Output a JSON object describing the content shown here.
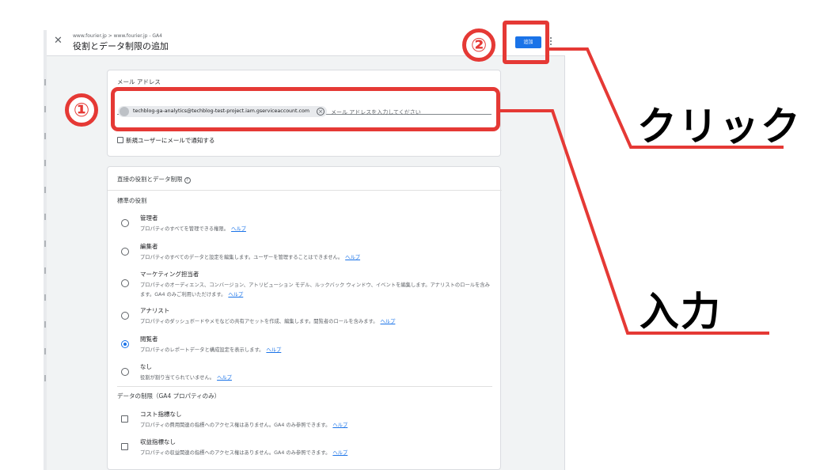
{
  "header": {
    "breadcrumb": "www.fourier.jp > www.fourier.jp - GA4",
    "title": "役割とデータ制限の追加",
    "add_label": "追加"
  },
  "email": {
    "section_label": "メール アドレス",
    "chip_text": "techblog-ga-analytics@techblog-test-project.iam.gserviceaccount.com",
    "placeholder": "メール アドレスを入力してください",
    "notify_label": "新規ユーザーにメールで通知する",
    "notify_checked": false
  },
  "roles": {
    "section_title": "直接の役割とデータ制限",
    "standard_title": "標準の役割",
    "items": [
      {
        "name": "管理者",
        "desc": "プロパティのすべてを管理できる権限。",
        "help": "ヘルプ",
        "selected": false
      },
      {
        "name": "編集者",
        "desc": "プロパティのすべてのデータと設定を編集します。ユーザーを管理することはできません。",
        "help": "ヘルプ",
        "selected": false
      },
      {
        "name": "マーケティング担当者",
        "desc": "プロパティのオーディエンス、コンバージョン、アトリビューション モデル、ルックバック ウィンドウ、イベントを編集します。アナリストのロールを含みます。GA4 のみご利用いただけます。",
        "help": "ヘルプ",
        "selected": false
      },
      {
        "name": "アナリスト",
        "desc": "プロパティのダッシュボードやメモなどの共有アセットを作成、編集します。閲覧者のロールを含みます。",
        "help": "ヘルプ",
        "selected": false
      },
      {
        "name": "閲覧者",
        "desc": "プロパティのレポートデータと構成設定を表示します。",
        "help": "ヘルプ",
        "selected": true
      },
      {
        "name": "なし",
        "desc": "役割が割り当てられていません。",
        "help": "ヘルプ",
        "selected": false
      }
    ]
  },
  "data_restrictions": {
    "title": "データの制限（GA4 プロパティのみ）",
    "items": [
      {
        "name": "コスト指標なし",
        "desc": "プロパティの費用関連の指標へのアクセス権はありません。GA4 のみ参照できます。",
        "help": "ヘルプ",
        "checked": false
      },
      {
        "name": "収益指標なし",
        "desc": "プロパティの収益関連の指標へのアクセス権はありません。GA4 のみ参照できます。",
        "help": "ヘルプ",
        "checked": false
      }
    ]
  },
  "annotations": {
    "step1": "①",
    "step2": "②",
    "click_label": "クリック",
    "input_label": "入力",
    "color": "#e53935"
  },
  "colors": {
    "primary": "#1a73e8",
    "link": "#1a73e8"
  }
}
